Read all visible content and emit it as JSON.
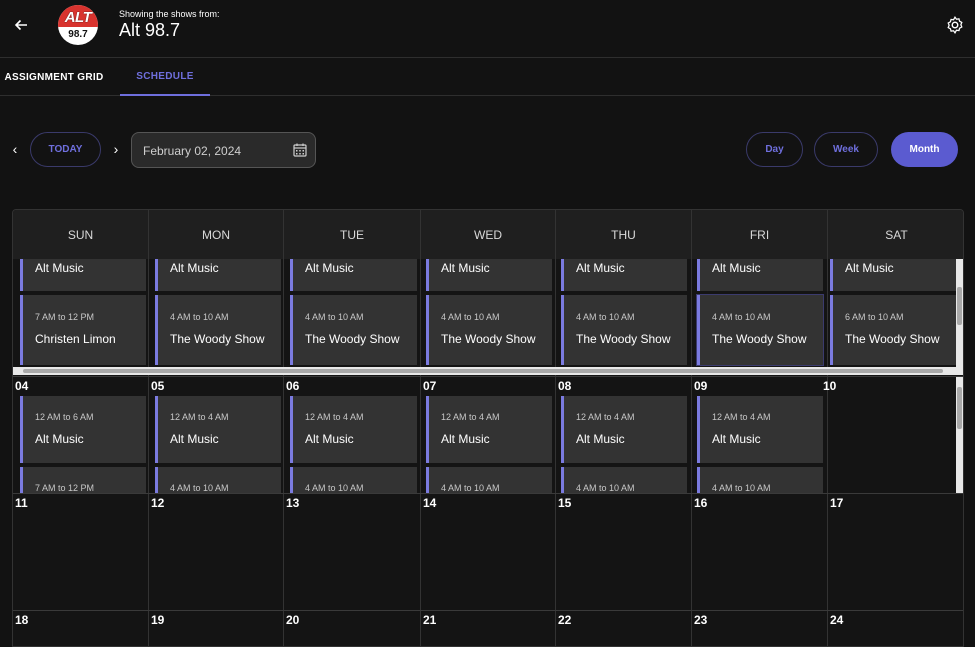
{
  "header": {
    "showing_label": "Showing the shows from:",
    "station_name": "Alt 98.7",
    "logo_text": "ALT",
    "logo_number": "98.7",
    "brand_color": "#d8332e"
  },
  "tabs": [
    {
      "label": "ASSIGNMENT GRID",
      "active": false
    },
    {
      "label": "SCHEDULE",
      "active": true
    }
  ],
  "toolbar": {
    "today_label": "TODAY",
    "date_value": "February 02, 2024",
    "views": [
      "Day",
      "Week",
      "Month"
    ],
    "active_view": "Month",
    "accent_color": "#5b5bd0"
  },
  "calendar": {
    "weekdays": [
      "SUN",
      "MON",
      "TUE",
      "WED",
      "THU",
      "FRI",
      "SAT"
    ],
    "week1": {
      "top_titles": [
        "Alt Music",
        "Alt Music",
        "Alt Music",
        "Alt Music",
        "Alt Music",
        "Alt Music",
        "Alt Music"
      ],
      "times": [
        "7 AM to 12 PM",
        "4 AM to 10 AM",
        "4 AM to 10 AM",
        "4 AM to 10 AM",
        "4 AM to 10 AM",
        "4 AM to 10 AM",
        "6 AM to 10 AM"
      ],
      "titles": [
        "Christen Limon",
        "The Woody Show",
        "The Woody Show",
        "The Woody Show",
        "The Woody Show",
        "The Woody Show",
        "The Woody Show"
      ]
    },
    "week2": {
      "days": [
        "04",
        "05",
        "06",
        "07",
        "08",
        "09",
        "10"
      ],
      "times": [
        "12 AM to 6 AM",
        "12 AM to 4 AM",
        "12 AM to 4 AM",
        "12 AM to 4 AM",
        "12 AM to 4 AM",
        "12 AM to 4 AM"
      ],
      "titles": [
        "Alt Music",
        "Alt Music",
        "Alt Music",
        "Alt Music",
        "Alt Music",
        "Alt Music"
      ],
      "next_times": [
        "7 AM to 12 PM",
        "4 AM to 10 AM",
        "4 AM to 10 AM",
        "4 AM to 10 AM",
        "4 AM to 10 AM",
        "4 AM to 10 AM"
      ]
    },
    "week3": {
      "days": [
        "11",
        "12",
        "13",
        "14",
        "15",
        "16",
        "17"
      ]
    },
    "week4": {
      "days": [
        "18",
        "19",
        "20",
        "21",
        "22",
        "23",
        "24"
      ]
    }
  },
  "icons": {
    "back": "back-arrow-icon",
    "settings": "gear-icon",
    "calendar": "calendar-icon",
    "prev": "chevron-left-icon",
    "next": "chevron-right-icon"
  }
}
